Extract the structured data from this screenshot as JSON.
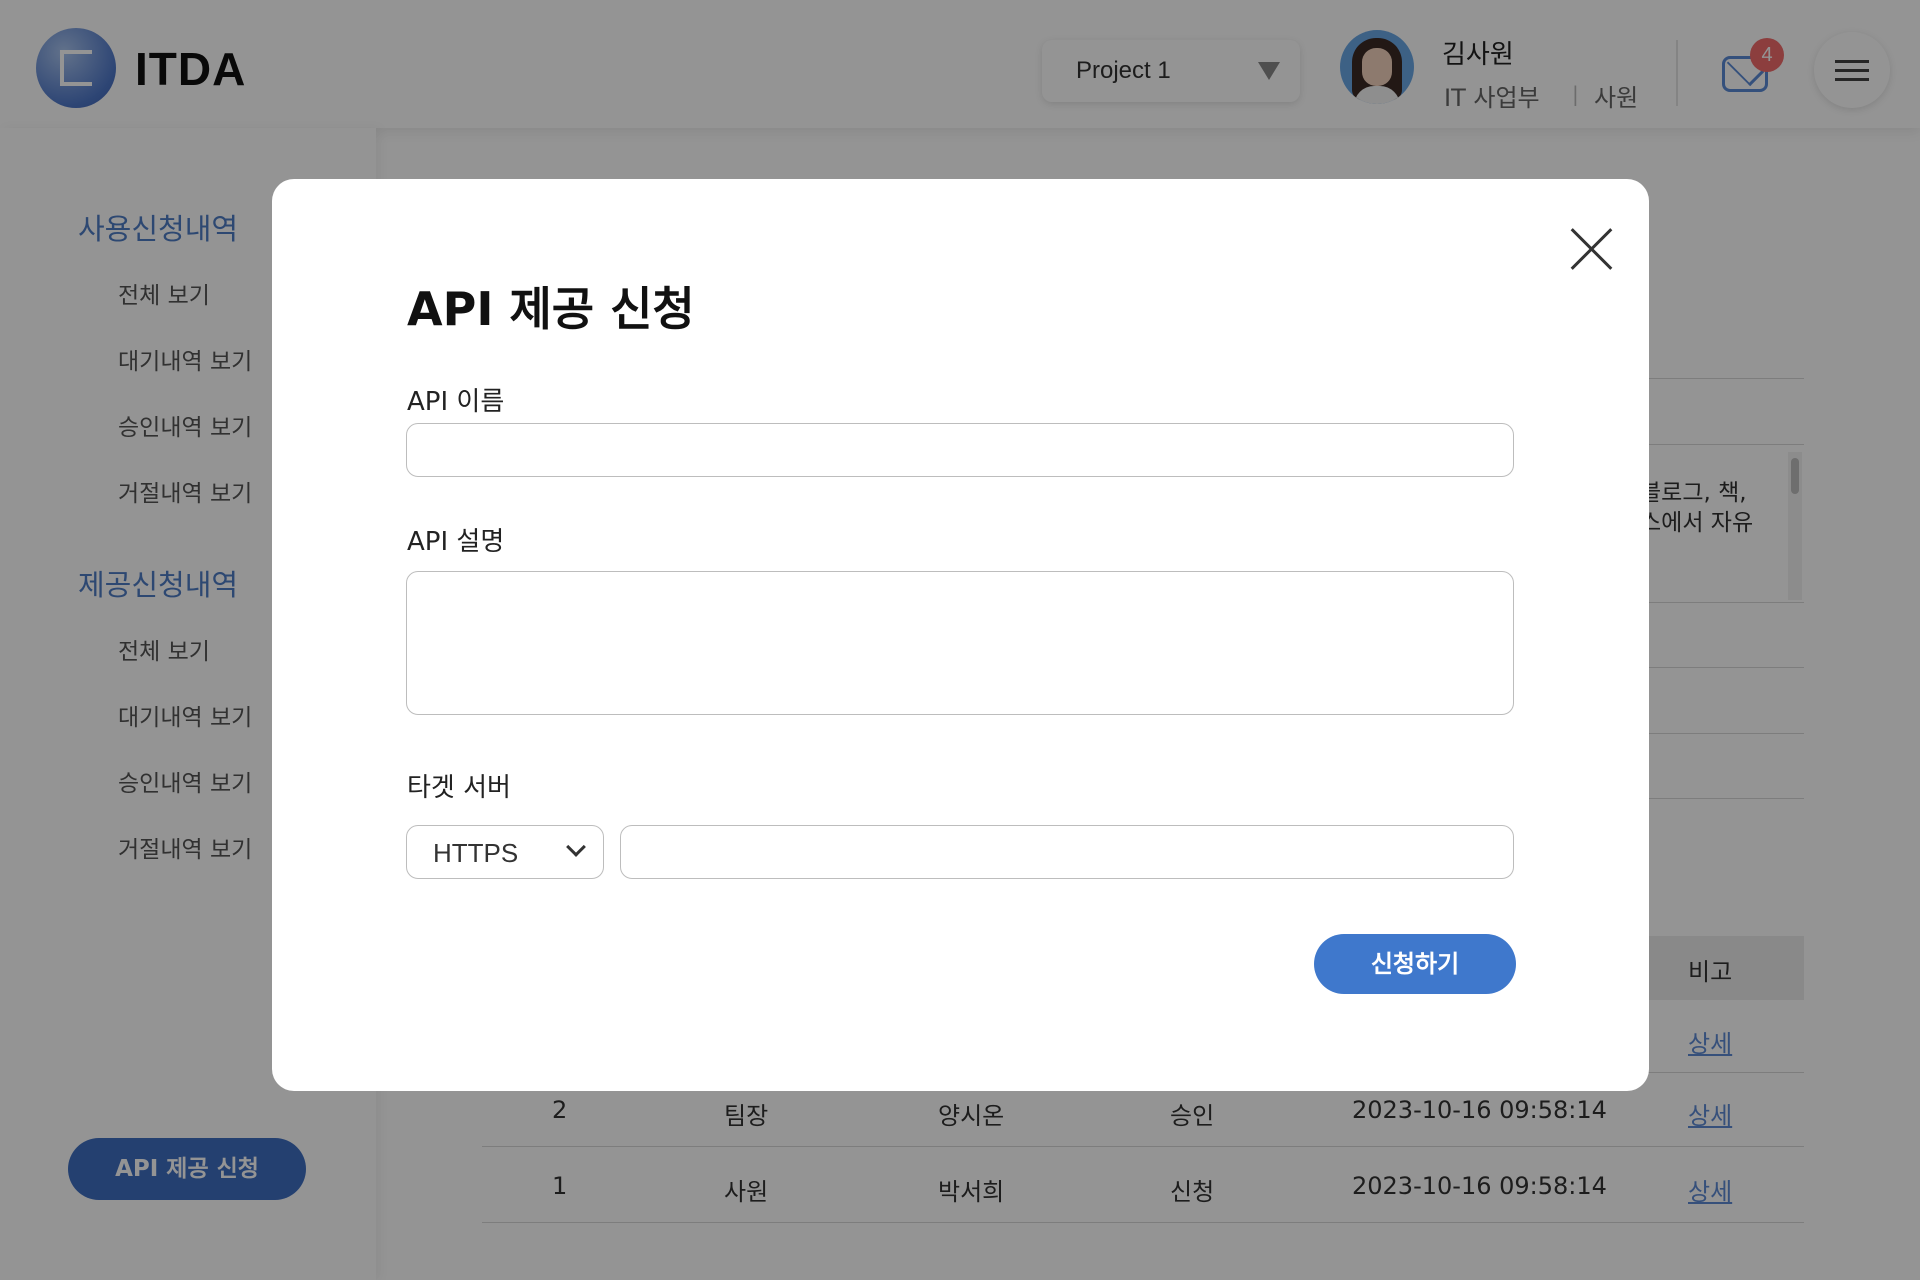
{
  "header": {
    "logo_text": "ITDA",
    "project_select": {
      "value": "Project 1"
    },
    "user": {
      "name": "김사원",
      "department": "IT 사업부",
      "separator": "|",
      "rank": "사원"
    },
    "notifications": {
      "count": "4"
    }
  },
  "sidebar": {
    "sections": [
      {
        "title": "사용신청내역",
        "items": [
          "전체 보기",
          "대기내역 보기",
          "승인내역 보기",
          "거절내역 보기"
        ]
      },
      {
        "title": "제공신청내역",
        "items": [
          "전체 보기",
          "대기내역 보기",
          "승인내역 보기",
          "거절내역 보기"
        ]
      }
    ],
    "cta_label": "API 제공 신청"
  },
  "background": {
    "text_lines": [
      "블로그, 책,",
      "스에서 자유"
    ],
    "table_header_last": "비고",
    "rows": [
      {
        "link": "상세"
      },
      {
        "no": "2",
        "rank": "팀장",
        "name": "양시온",
        "status": "승인",
        "datetime": "2023-10-16 09:58:14",
        "link": "상세"
      },
      {
        "no": "1",
        "rank": "사원",
        "name": "박서희",
        "status": "신청",
        "datetime": "2023-10-16 09:58:14",
        "link": "상세"
      }
    ]
  },
  "modal": {
    "title": "API 제공 신청",
    "fields": {
      "api_name": {
        "label": "API 이름",
        "value": "",
        "placeholder": ""
      },
      "api_description": {
        "label": "API 설명",
        "value": "",
        "placeholder": ""
      },
      "target_server": {
        "label": "타겟 서버",
        "protocol": "HTTPS",
        "value": "",
        "placeholder": ""
      }
    },
    "submit_label": "신청하기"
  },
  "colors": {
    "accent": "#3f78cc",
    "sidebar_section": "#4f7cc5",
    "badge": "#f26b6b",
    "overlay": "rgba(0,0,0,0.42)"
  }
}
